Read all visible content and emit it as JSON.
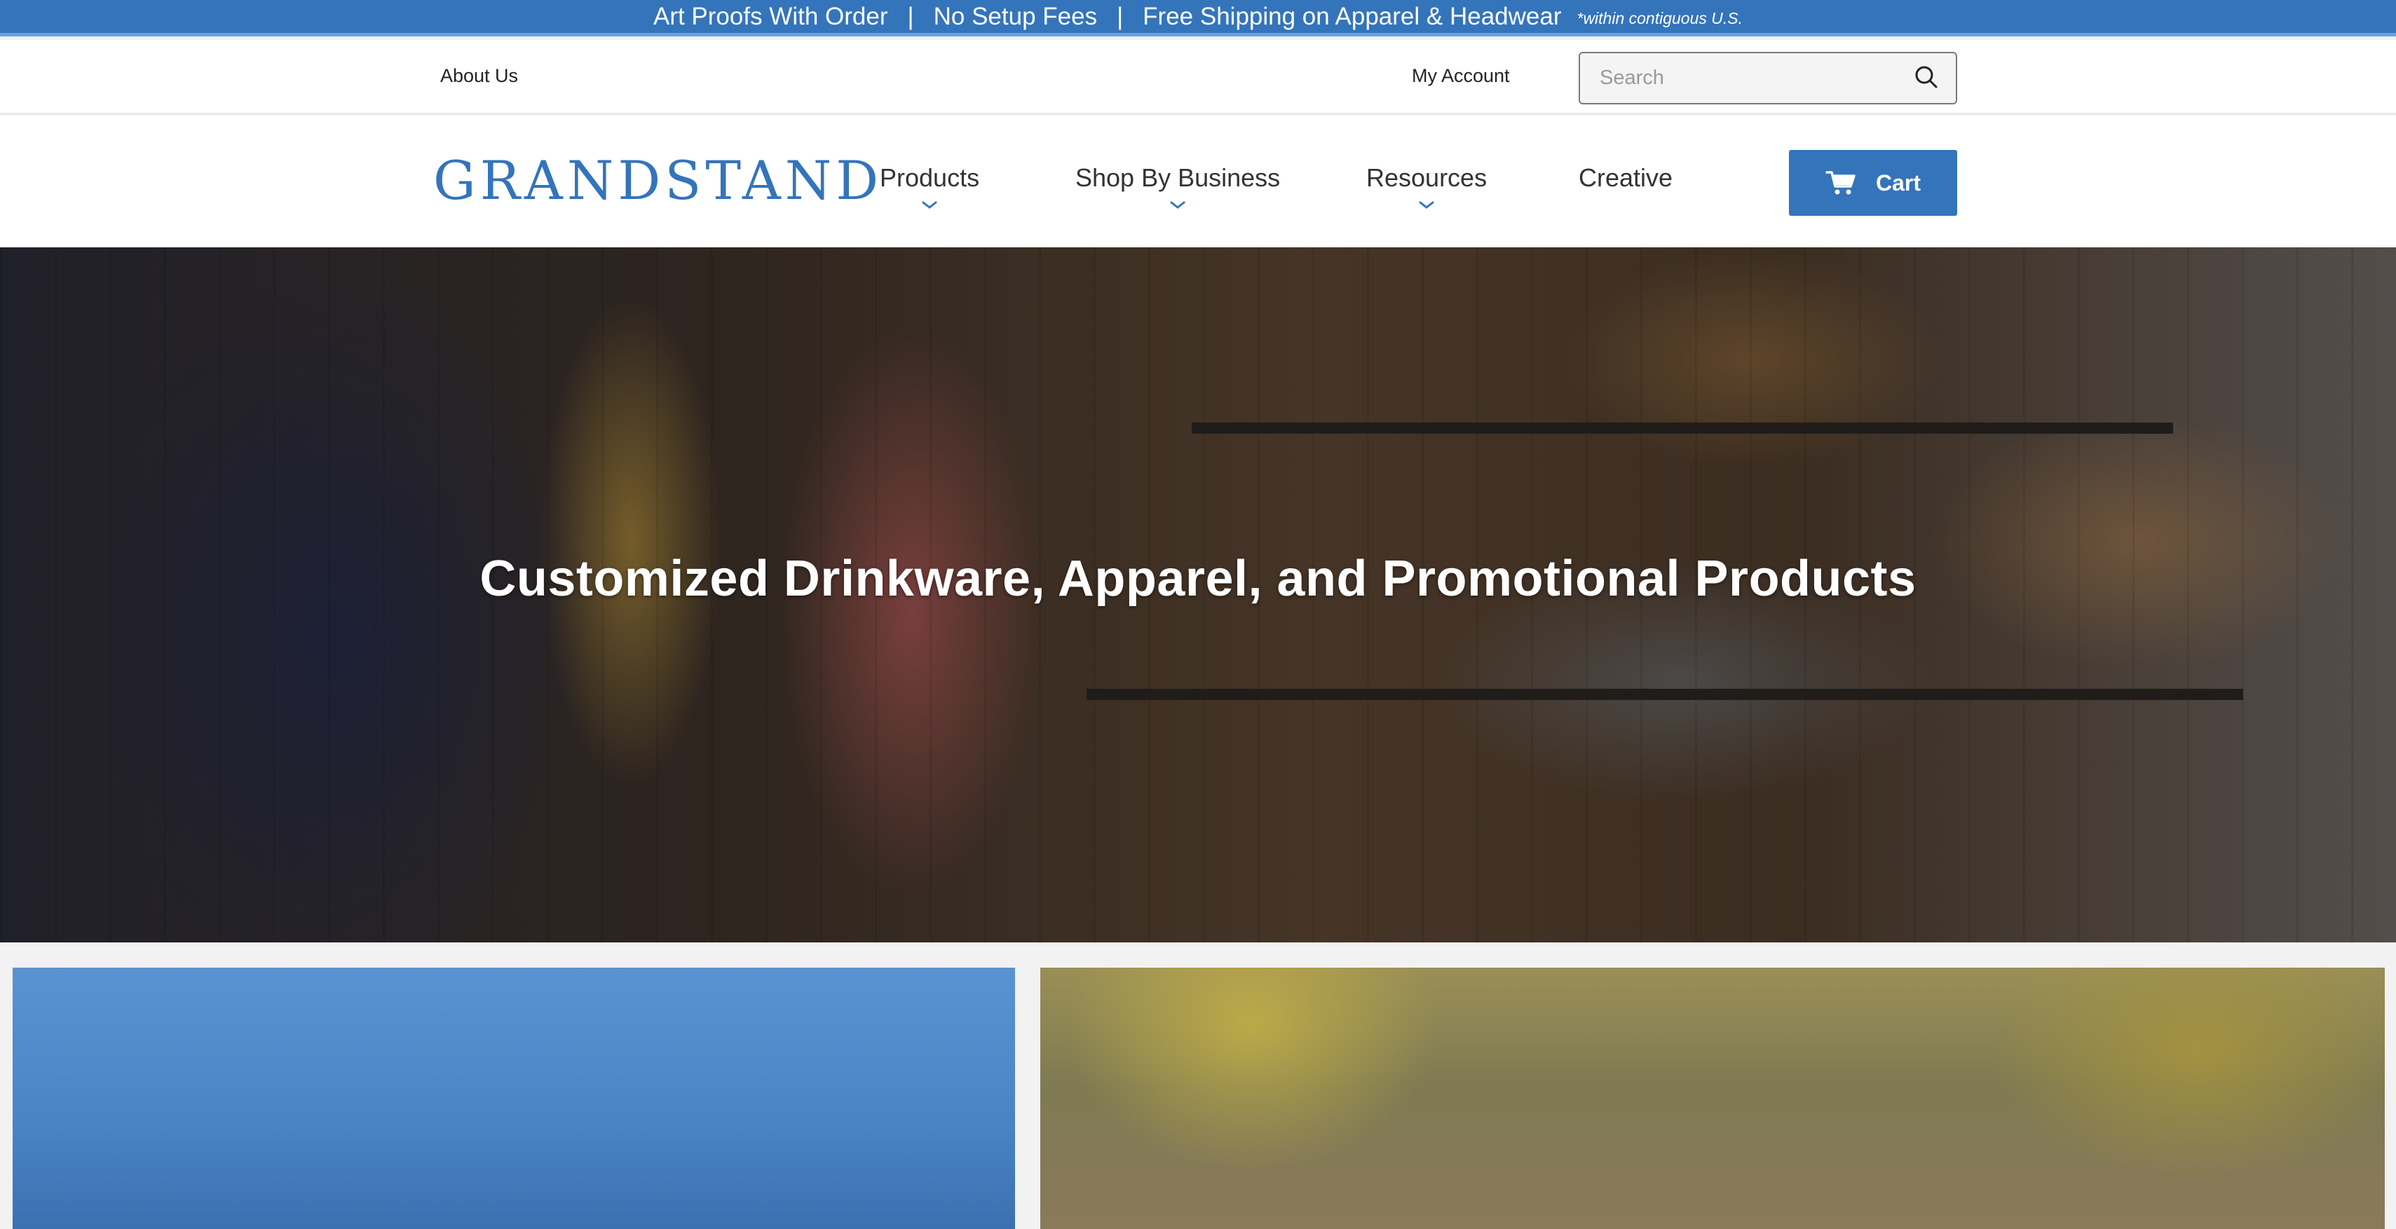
{
  "promo_bar": {
    "messages": [
      "Art Proofs With Order",
      "No Setup Fees",
      "Free Shipping on Apparel & Headwear"
    ],
    "separator": "|",
    "footnote": "*within contiguous U.S."
  },
  "utility_bar": {
    "about_label": "About Us",
    "account_label": "My Account",
    "search_placeholder": "Search",
    "search_value": ""
  },
  "header": {
    "logo_text": "GRANDSTAND",
    "nav": [
      {
        "label": "Products",
        "has_dropdown": true
      },
      {
        "label": "Shop By Business",
        "has_dropdown": true
      },
      {
        "label": "Resources",
        "has_dropdown": true
      },
      {
        "label": "Creative",
        "has_dropdown": false
      }
    ],
    "cart_label": "Cart"
  },
  "hero": {
    "title": "Customized Drinkware, Apparel, and Promotional Products"
  },
  "icons": {
    "search": "search-icon",
    "cart": "cart-icon",
    "dropdown": "chevron-down-icon"
  },
  "colors": {
    "brand_blue": "#3474bb",
    "text_dark": "#222222",
    "white": "#ffffff"
  }
}
